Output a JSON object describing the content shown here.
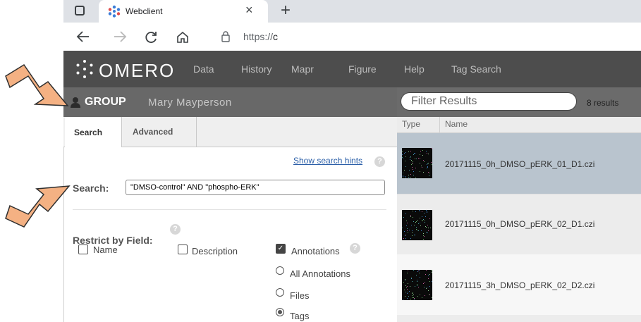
{
  "browser": {
    "tab_title": "Webclient",
    "tab_close": "×",
    "new_tab": "+",
    "url_prefix": "https://",
    "url_host": "c"
  },
  "nav": {
    "logo": "OMERO",
    "items": [
      "Data",
      "History",
      "Mapr",
      "Figure",
      "Help",
      "Tag Search"
    ]
  },
  "group": {
    "label": "GROUP",
    "user": "Mary Mayperson"
  },
  "search_panel": {
    "tabs": [
      "Search",
      "Advanced"
    ],
    "hints_link": "Show search hints",
    "help_mark": "?",
    "search_label": "Search:",
    "search_value": "\"DMSO-control\" AND \"phospho-ERK\"",
    "restrict_label": "Restrict by Field:",
    "fields": {
      "name": "Name",
      "description": "Description",
      "annotations": "Annotations"
    },
    "annotation_options": [
      "All Annotations",
      "Files",
      "Tags"
    ]
  },
  "results": {
    "filter_placeholder": "Filter Results",
    "count": "8 results",
    "columns": [
      "Type",
      "Name"
    ],
    "rows": [
      {
        "name": "20171115_0h_DMSO_pERK_01_D1.czi"
      },
      {
        "name": "20171115_0h_DMSO_pERK_02_D1.czi"
      },
      {
        "name": "20171115_3h_DMSO_pERK_02_D2.czi"
      }
    ]
  },
  "colors": {
    "nav_bg": "#4d4d4d",
    "group_bar": "#686868",
    "selected_row": "#b9c4ce",
    "arrow_fill": "#f4b183",
    "link": "#2b5fa8"
  }
}
